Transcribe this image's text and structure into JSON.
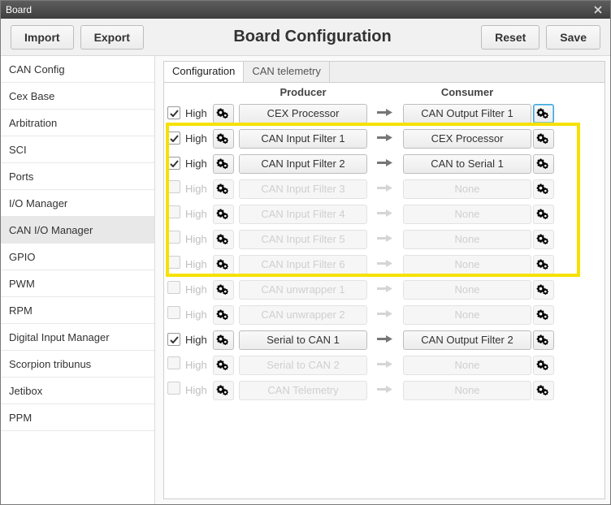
{
  "window": {
    "title": "Board"
  },
  "toolbar": {
    "import": "Import",
    "export": "Export",
    "heading": "Board Configuration",
    "reset": "Reset",
    "save": "Save"
  },
  "sidebar": {
    "items": [
      "CAN Config",
      "Cex Base",
      "Arbitration",
      "SCI",
      "Ports",
      "I/O Manager",
      "CAN I/O Manager",
      "GPIO",
      "PWM",
      "RPM",
      "Digital Input Manager",
      "Scorpion tribunus",
      "Jetibox",
      "PPM"
    ],
    "active_index": 6
  },
  "tabs": {
    "items": [
      "Configuration",
      "CAN telemetry"
    ],
    "active_index": 0
  },
  "table": {
    "headers": {
      "producer": "Producer",
      "consumer": "Consumer"
    },
    "high_label": "High",
    "rows": [
      {
        "checked": true,
        "enabled": true,
        "producer": "CEX Processor",
        "consumer": "CAN Output Filter 1",
        "gear2_highlight": true
      },
      {
        "checked": true,
        "enabled": true,
        "producer": "CAN Input Filter 1",
        "consumer": "CEX Processor"
      },
      {
        "checked": true,
        "enabled": true,
        "producer": "CAN Input Filter 2",
        "consumer": "CAN to Serial 1"
      },
      {
        "checked": false,
        "enabled": false,
        "producer": "CAN Input Filter 3",
        "consumer": "None"
      },
      {
        "checked": false,
        "enabled": false,
        "producer": "CAN Input Filter 4",
        "consumer": "None"
      },
      {
        "checked": false,
        "enabled": false,
        "producer": "CAN Input Filter 5",
        "consumer": "None"
      },
      {
        "checked": false,
        "enabled": false,
        "producer": "CAN Input Filter 6",
        "consumer": "None"
      },
      {
        "checked": false,
        "enabled": false,
        "producer": "CAN unwrapper 1",
        "consumer": "None"
      },
      {
        "checked": false,
        "enabled": false,
        "producer": "CAN unwrapper 2",
        "consumer": "None"
      },
      {
        "checked": true,
        "enabled": true,
        "producer": "Serial to CAN 1",
        "consumer": "CAN Output Filter 2"
      },
      {
        "checked": false,
        "enabled": false,
        "producer": "Serial to CAN 2",
        "consumer": "None"
      },
      {
        "checked": false,
        "enabled": false,
        "producer": "CAN Telemetry",
        "consumer": "None"
      }
    ],
    "highlight": {
      "start": 1,
      "end": 6
    }
  }
}
